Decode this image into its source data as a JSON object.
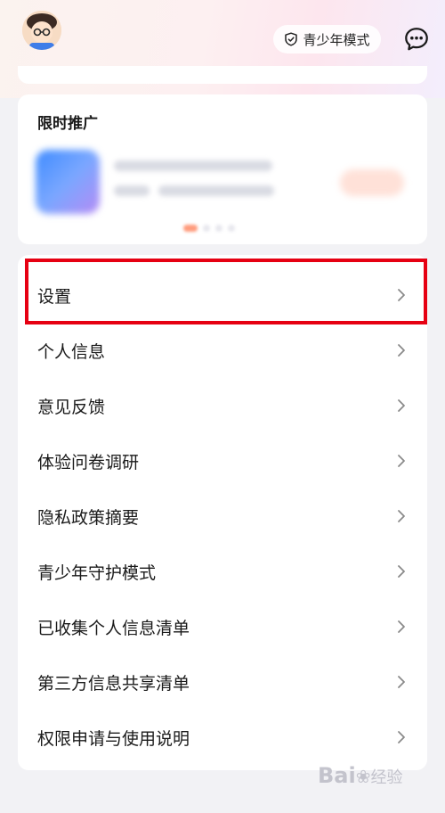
{
  "header": {
    "youth_mode_label": "青少年模式"
  },
  "promo": {
    "title": "限时推广"
  },
  "menu": {
    "items": [
      {
        "label": "设置"
      },
      {
        "label": "个人信息"
      },
      {
        "label": "意见反馈"
      },
      {
        "label": "体验问卷调研"
      },
      {
        "label": "隐私政策摘要"
      },
      {
        "label": "青少年守护模式"
      },
      {
        "label": "已收集个人信息清单"
      },
      {
        "label": "第三方信息共享清单"
      },
      {
        "label": "权限申请与使用说明"
      }
    ]
  },
  "watermark": {
    "text": "Bai",
    "suffix": "经验"
  },
  "colors": {
    "highlight": "#e60012",
    "background": "#f2f2f5"
  },
  "icons": {
    "youth": "shield-icon",
    "message": "chat-bubble-icon",
    "chevron": "chevron-right-icon"
  }
}
